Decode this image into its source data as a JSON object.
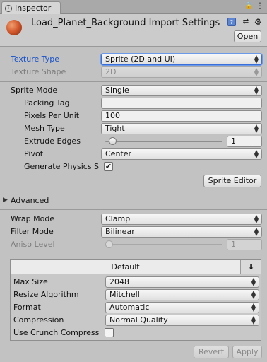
{
  "tab": {
    "label": "Inspector",
    "icon": "info-icon"
  },
  "window_controls": {
    "lock": "lock-icon",
    "menu": "context-menu-icon"
  },
  "header": {
    "title": "Load_Planet_Background Import Settings",
    "icons": [
      "help-book-icon",
      "preset-sliders-icon",
      "gear-icon"
    ],
    "open_label": "Open"
  },
  "texture": {
    "type_label": "Texture Type",
    "type_value": "Sprite (2D and UI)",
    "shape_label": "Texture Shape",
    "shape_value": "2D"
  },
  "sprite": {
    "mode_label": "Sprite Mode",
    "mode_value": "Single",
    "packing_label": "Packing Tag",
    "packing_value": "",
    "ppu_label": "Pixels Per Unit",
    "ppu_value": "100",
    "mesh_label": "Mesh Type",
    "mesh_value": "Tight",
    "extrude_label": "Extrude Edges",
    "extrude_value": "1",
    "extrude_fraction": 0.03,
    "pivot_label": "Pivot",
    "pivot_value": "Center",
    "physics_label": "Generate Physics S",
    "physics_checked": true,
    "editor_label": "Sprite Editor"
  },
  "advanced": {
    "label": "Advanced"
  },
  "wrap": {
    "wrap_label": "Wrap Mode",
    "wrap_value": "Clamp",
    "filter_label": "Filter Mode",
    "filter_value": "Bilinear",
    "aniso_label": "Aniso Level",
    "aniso_value": "1",
    "aniso_fraction": 0.0
  },
  "platform": {
    "tab_label": "Default",
    "max_size_label": "Max Size",
    "max_size_value": "2048",
    "resize_label": "Resize Algorithm",
    "resize_value": "Mitchell",
    "format_label": "Format",
    "format_value": "Automatic",
    "compression_label": "Compression",
    "compression_value": "Normal Quality",
    "crunch_label": "Use Crunch Compress",
    "crunch_checked": false
  },
  "footer": {
    "revert_label": "Revert",
    "apply_label": "Apply"
  },
  "colors": {
    "focus_label": "#1550c8",
    "focus_border": "#3a6ed8",
    "background": "#c2c2c2"
  }
}
